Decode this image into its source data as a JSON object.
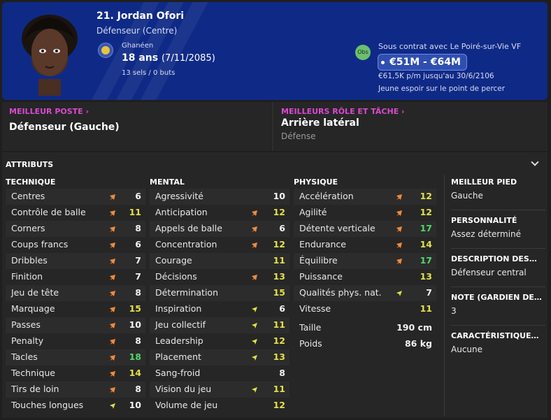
{
  "player": {
    "number_name": "21. Jordan Ofori",
    "position": "Défenseur (Centre)",
    "nationality": "Ghanéen",
    "age": "18 ans",
    "dob": "(7/11/2085)",
    "caps": "13 sels / 0 buts"
  },
  "contract": {
    "obs_label": "Obs",
    "text": "Sous contrat avec Le Poiré-sur-Vie VF",
    "value": "€51M - €64M",
    "wage": "€61,5K p/m jusqu'au 30/6/2106",
    "status": "Jeune espoir sur le point de percer"
  },
  "best_position": {
    "link": "MEILLEUR POSTE",
    "value": "Défenseur (Gauche)"
  },
  "best_role": {
    "link": "MEILLEURS RÔLE ET TÂCHE",
    "value": "Arrière latéral",
    "sub": "Défense"
  },
  "attributes": {
    "title": "ATTRIBUTS",
    "technique_title": "TECHNIQUE",
    "mental_title": "MENTAL",
    "physique_title": "PHYSIQUE",
    "technique": [
      {
        "label": "Centres",
        "value": "6",
        "arrow": "up",
        "color": "white"
      },
      {
        "label": "Contrôle de balle",
        "value": "11",
        "arrow": "up",
        "color": "yellow"
      },
      {
        "label": "Corners",
        "value": "8",
        "arrow": "up",
        "color": "white"
      },
      {
        "label": "Coups francs",
        "value": "6",
        "arrow": "up",
        "color": "white"
      },
      {
        "label": "Dribbles",
        "value": "7",
        "arrow": "up",
        "color": "white"
      },
      {
        "label": "Finition",
        "value": "7",
        "arrow": "up",
        "color": "white"
      },
      {
        "label": "Jeu de tête",
        "value": "8",
        "arrow": "up",
        "color": "white"
      },
      {
        "label": "Marquage",
        "value": "15",
        "arrow": "up",
        "color": "yellow"
      },
      {
        "label": "Passes",
        "value": "10",
        "arrow": "up",
        "color": "white"
      },
      {
        "label": "Penalty",
        "value": "8",
        "arrow": "up",
        "color": "white"
      },
      {
        "label": "Tacles",
        "value": "18",
        "arrow": "up",
        "color": "green"
      },
      {
        "label": "Technique",
        "value": "14",
        "arrow": "up",
        "color": "yellow"
      },
      {
        "label": "Tirs de loin",
        "value": "8",
        "arrow": "up",
        "color": "white"
      },
      {
        "label": "Touches longues",
        "value": "10",
        "arrow": "down",
        "color": "white"
      }
    ],
    "mental": [
      {
        "label": "Agressivité",
        "value": "10",
        "arrow": "none",
        "color": "white"
      },
      {
        "label": "Anticipation",
        "value": "12",
        "arrow": "up",
        "color": "yellow"
      },
      {
        "label": "Appels de balle",
        "value": "6",
        "arrow": "up",
        "color": "white"
      },
      {
        "label": "Concentration",
        "value": "12",
        "arrow": "up",
        "color": "yellow"
      },
      {
        "label": "Courage",
        "value": "11",
        "arrow": "none",
        "color": "yellow"
      },
      {
        "label": "Décisions",
        "value": "13",
        "arrow": "up",
        "color": "yellow"
      },
      {
        "label": "Détermination",
        "value": "15",
        "arrow": "none",
        "color": "yellow"
      },
      {
        "label": "Inspiration",
        "value": "6",
        "arrow": "down",
        "color": "white"
      },
      {
        "label": "Jeu collectif",
        "value": "11",
        "arrow": "down",
        "color": "yellow"
      },
      {
        "label": "Leadership",
        "value": "12",
        "arrow": "down",
        "color": "yellow"
      },
      {
        "label": "Placement",
        "value": "13",
        "arrow": "down",
        "color": "yellow"
      },
      {
        "label": "Sang-froid",
        "value": "8",
        "arrow": "none",
        "color": "white"
      },
      {
        "label": "Vision du jeu",
        "value": "11",
        "arrow": "down",
        "color": "yellow"
      },
      {
        "label": "Volume de jeu",
        "value": "12",
        "arrow": "none",
        "color": "yellow"
      }
    ],
    "physique": [
      {
        "label": "Accélération",
        "value": "12",
        "arrow": "up",
        "color": "yellow"
      },
      {
        "label": "Agilité",
        "value": "12",
        "arrow": "up",
        "color": "yellow"
      },
      {
        "label": "Détente verticale",
        "value": "17",
        "arrow": "up",
        "color": "green"
      },
      {
        "label": "Endurance",
        "value": "14",
        "arrow": "up",
        "color": "yellow"
      },
      {
        "label": "Équilibre",
        "value": "17",
        "arrow": "up",
        "color": "green"
      },
      {
        "label": "Puissance",
        "value": "13",
        "arrow": "none",
        "color": "yellow"
      },
      {
        "label": "Qualités phys. nat.",
        "value": "7",
        "arrow": "down",
        "color": "white"
      },
      {
        "label": "Vitesse",
        "value": "11",
        "arrow": "none",
        "color": "yellow"
      }
    ],
    "height_label": "Taille",
    "height_value": "190 cm",
    "weight_label": "Poids",
    "weight_value": "86 kg"
  },
  "side": {
    "foot_title": "MEILLEUR PIED",
    "foot_value": "Gauche",
    "personality_title": "PERSONNALITÉ",
    "personality_value": "Assez déterminé",
    "description_title": "DESCRIPTION DES…",
    "description_value": "Défenseur central",
    "note_title": "NOTE (GARDIEN DE…",
    "note_value": "3",
    "traits_title": "CARACTÉRISTIQUE…",
    "traits_value": "Aucune"
  },
  "colors": {
    "header_bg": "#0f2a86",
    "link": "#d94ad0",
    "arrow_up": "#f08a3c",
    "arrow_down": "#e3e04a",
    "value_yellow": "#e3e04a",
    "value_green": "#4fd86a"
  }
}
